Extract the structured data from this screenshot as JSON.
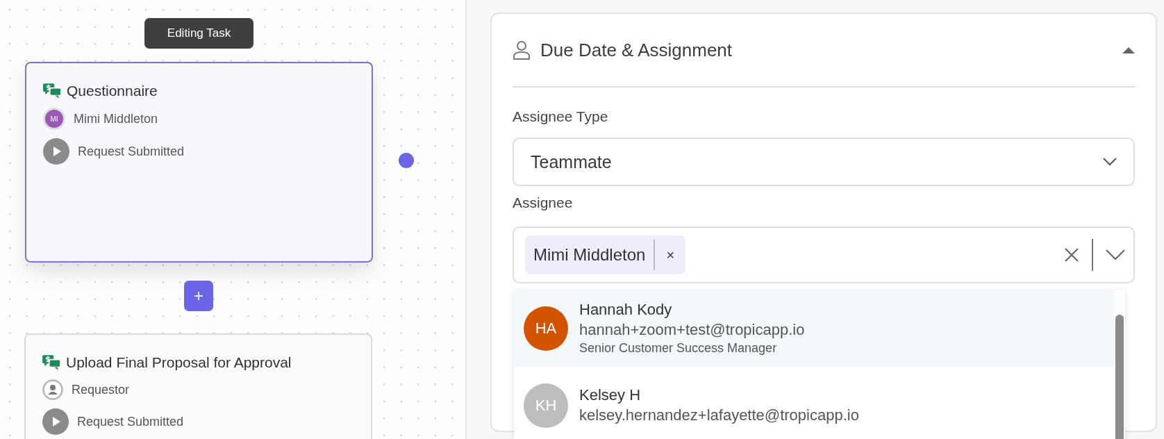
{
  "canvas": {
    "tooltip": "Editing Task",
    "add_button": "+",
    "tasks": [
      {
        "title": "Questionnaire",
        "assignee": {
          "kind": "avatar",
          "initials": "MI",
          "color": "#9b59b6",
          "name": "Mimi Middleton"
        },
        "trigger": "Request Submitted",
        "selected": true
      },
      {
        "title": "Upload Final Proposal for Approval",
        "assignee": {
          "kind": "role",
          "name": "Requestor"
        },
        "trigger": "Request Submitted",
        "selected": false
      }
    ]
  },
  "panel": {
    "section_title": "Due Date & Assignment",
    "expanded": true,
    "assignee_type": {
      "label": "Assignee Type",
      "value": "Teammate"
    },
    "assignee": {
      "label": "Assignee",
      "tags": [
        {
          "label": "Mimi Middleton",
          "remove": "×"
        }
      ]
    },
    "options": [
      {
        "initials": "HA",
        "color": "#d35400",
        "name": "Hannah Kody",
        "email": "hannah+zoom+test@tropicapp.io",
        "title": "Senior Customer Success Manager",
        "selected": true
      },
      {
        "initials": "KH",
        "color": "#bdbdbd",
        "name": "Kelsey H",
        "email": "kelsey.hernandez+lafayette@tropicapp.io",
        "selected": false
      }
    ]
  }
}
